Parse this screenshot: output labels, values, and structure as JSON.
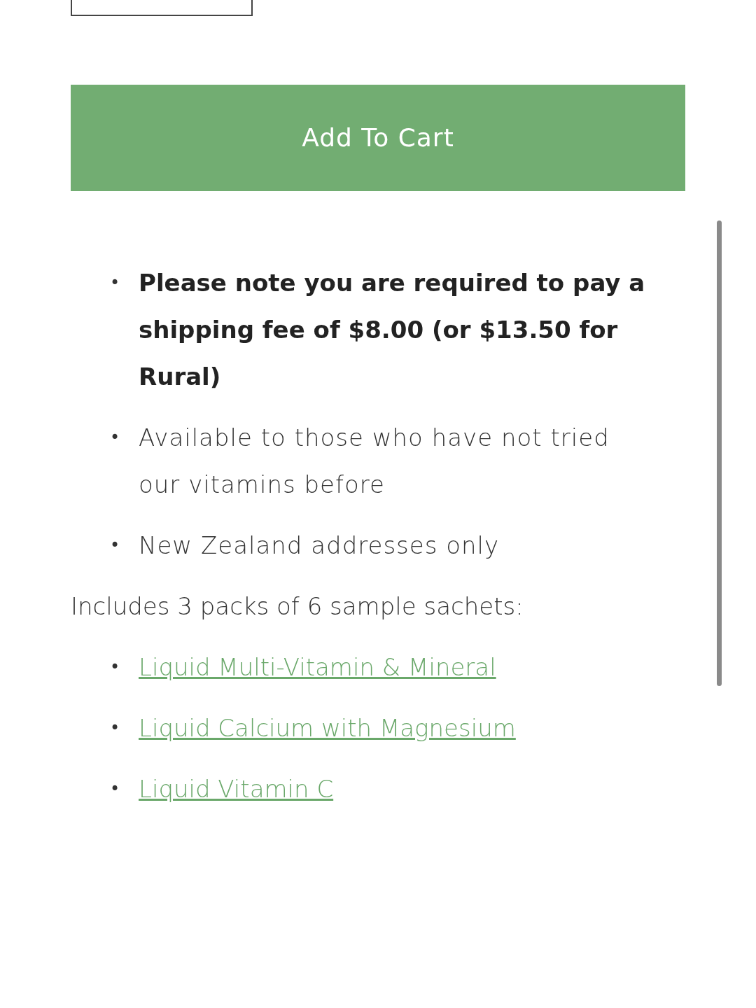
{
  "add_to_cart": "Add To Cart",
  "notes": [
    {
      "marker": "•",
      "text": "Please note you are required to pay a shipping fee of $8.00 (or $13.50 for Rural)",
      "bold": true
    },
    {
      "marker": "•",
      "text": "Available to those who have not tried our vitamins before",
      "bold": false
    },
    {
      "marker": "•",
      "text": "New Zealand addresses only",
      "bold": false
    }
  ],
  "includes_heading": "Includes 3 packs of 6 sample sachets:",
  "products": [
    {
      "marker": "•",
      "text": "Liquid Multi-Vitamin & Mineral"
    },
    {
      "marker": "•",
      "text": "Liquid Calcium with Magnesium"
    },
    {
      "marker": "•",
      "text": "Liquid Vitamin C"
    }
  ]
}
